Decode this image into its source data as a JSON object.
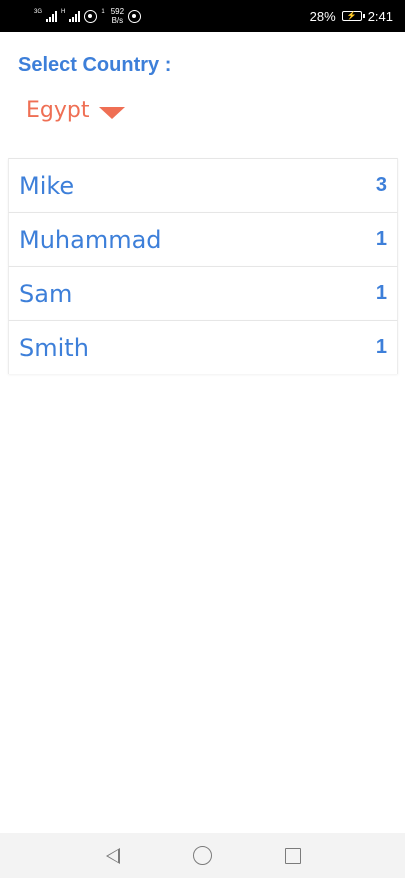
{
  "status_bar": {
    "network_label_1": "3G",
    "network_label_2": "H",
    "net_speed_value": "592",
    "net_speed_unit": "B/s",
    "net_speed_prefix": "1",
    "battery_percent": "28%",
    "time": "2:41",
    "icons": [
      "signal-icon",
      "signal-icon",
      "hotspot-icon",
      "hotspot-icon",
      "battery-charging-icon"
    ]
  },
  "header": {
    "select_label": "Select Country :"
  },
  "country_select": {
    "selected": "Egypt",
    "icon": "dropdown-arrow-icon"
  },
  "list": {
    "rows": [
      {
        "name": "Mike",
        "count": "3"
      },
      {
        "name": "Muhammad",
        "count": "1"
      },
      {
        "name": "Sam",
        "count": "1"
      },
      {
        "name": "Smith",
        "count": "1"
      }
    ]
  },
  "navbar": {
    "icons": [
      "back-icon",
      "home-icon",
      "recents-icon"
    ]
  },
  "colors": {
    "accent_blue": "#3d7fd9",
    "accent_orange": "#ef6f54",
    "statusbar_bg": "#000000",
    "navbar_bg": "#f3f3f3"
  }
}
